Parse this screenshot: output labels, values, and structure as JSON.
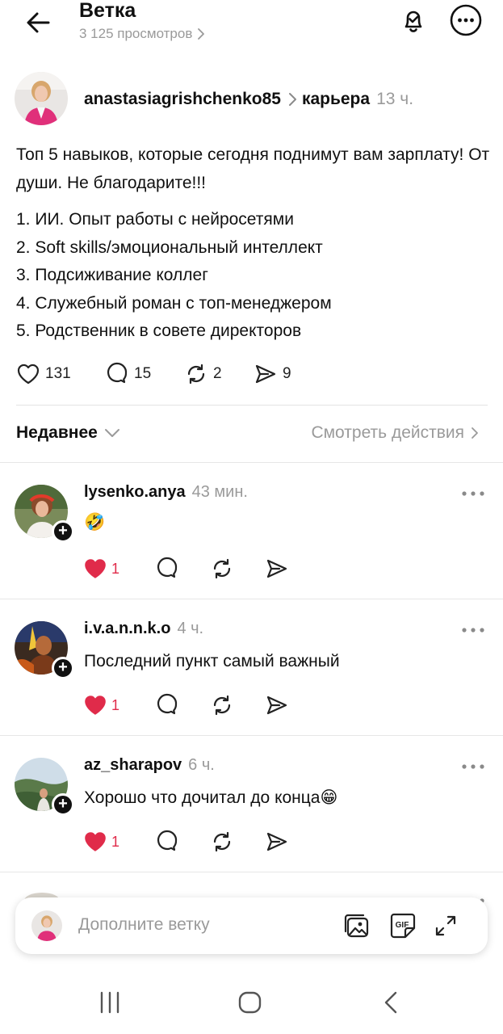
{
  "header": {
    "title": "Ветка",
    "views": "3 125 просмотров"
  },
  "post": {
    "username": "anastasiagrishchenko85",
    "topic": "карьера",
    "time": "13 ч.",
    "text": "Топ 5 навыков, которые сегодня поднимут вам зарплату! От души. Не благодарите!!!",
    "list": [
      "1. ИИ. Опыт работы с нейросетями",
      "2. Soft skills/эмоциональный интеллект",
      "3. Подсиживание коллег",
      "4. Служебный роман с топ-менеджером",
      "5. Родственник в совете директоров"
    ],
    "stats": {
      "likes": "131",
      "comments": "15",
      "reposts": "2",
      "shares": "9"
    }
  },
  "sort": {
    "label": "Недавнее",
    "activity_label": "Смотреть действия"
  },
  "comments": [
    {
      "username": "lysenko.anya",
      "time": "43 мин.",
      "text": "🤣",
      "likes": "1"
    },
    {
      "username": "i.v.a.n.n.k.o",
      "time": "4 ч.",
      "text": "Последний пункт самый важный",
      "likes": "1"
    },
    {
      "username": "az_sharapov",
      "time": "6 ч.",
      "text": "Хорошо что дочитал до конца😁",
      "likes": "1"
    }
  ],
  "composer": {
    "placeholder": "Дополните ветку",
    "gif_label": "GIF"
  },
  "colors": {
    "like_red": "#e02b4a",
    "muted_gray": "#9a9a9a"
  },
  "icons": [
    "back-arrow-icon",
    "bell-check-icon",
    "more-circle-icon",
    "heart-icon",
    "comment-icon",
    "repost-icon",
    "send-icon",
    "chevron-down-icon",
    "chevron-right-icon",
    "image-icon",
    "gif-icon",
    "expand-icon",
    "recents-nav-icon",
    "home-nav-icon",
    "back-nav-icon"
  ]
}
